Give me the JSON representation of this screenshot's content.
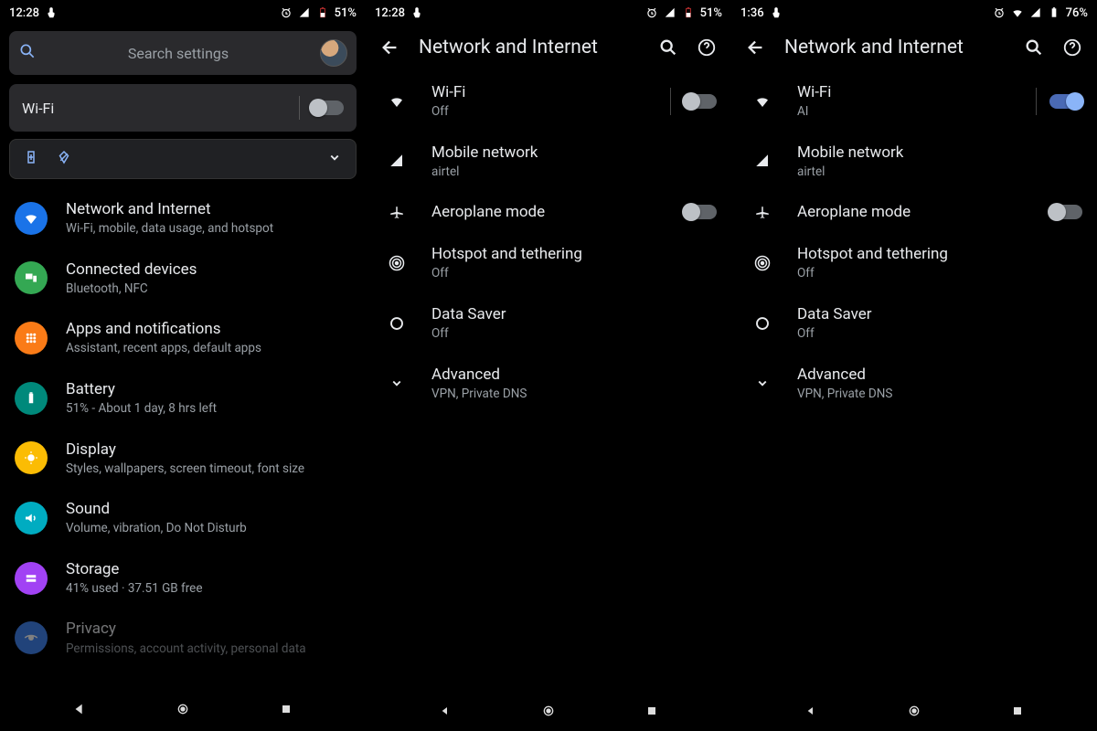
{
  "s1": {
    "status": {
      "time": "12:28",
      "battery": "51%"
    },
    "search_placeholder": "Search settings",
    "wifi_label": "Wi-Fi",
    "rows": [
      {
        "title": "Network and Internet",
        "sub": "Wi-Fi, mobile, data usage, and hotspot"
      },
      {
        "title": "Connected devices",
        "sub": "Bluetooth, NFC"
      },
      {
        "title": "Apps and notifications",
        "sub": "Assistant, recent apps, default apps"
      },
      {
        "title": "Battery",
        "sub": "51% - About 1 day, 8 hrs left"
      },
      {
        "title": "Display",
        "sub": "Styles, wallpapers, screen timeout, font size"
      },
      {
        "title": "Sound",
        "sub": "Volume, vibration, Do Not Disturb"
      },
      {
        "title": "Storage",
        "sub": "41% used · 37.51 GB free"
      },
      {
        "title": "Privacy",
        "sub": "Permissions, account activity, personal data"
      }
    ]
  },
  "s2": {
    "status": {
      "time": "12:28",
      "battery": "51%"
    },
    "header": "Network and Internet",
    "rows": {
      "wifi": {
        "title": "Wi-Fi",
        "sub": "Off"
      },
      "mobile": {
        "title": "Mobile network",
        "sub": "airtel"
      },
      "airplane": {
        "title": "Aeroplane mode"
      },
      "hotspot": {
        "title": "Hotspot and tethering",
        "sub": "Off"
      },
      "datasaver": {
        "title": "Data Saver",
        "sub": "Off"
      },
      "advanced": {
        "title": "Advanced",
        "sub": "VPN, Private DNS"
      }
    }
  },
  "s3": {
    "status": {
      "time": "1:36",
      "battery": "76%"
    },
    "header": "Network and Internet",
    "rows": {
      "wifi": {
        "title": "Wi-Fi",
        "sub": "AI"
      },
      "mobile": {
        "title": "Mobile network",
        "sub": "airtel"
      },
      "airplane": {
        "title": "Aeroplane mode"
      },
      "hotspot": {
        "title": "Hotspot and tethering",
        "sub": "Off"
      },
      "datasaver": {
        "title": "Data Saver",
        "sub": "Off"
      },
      "advanced": {
        "title": "Advanced",
        "sub": "VPN, Private DNS"
      }
    }
  }
}
